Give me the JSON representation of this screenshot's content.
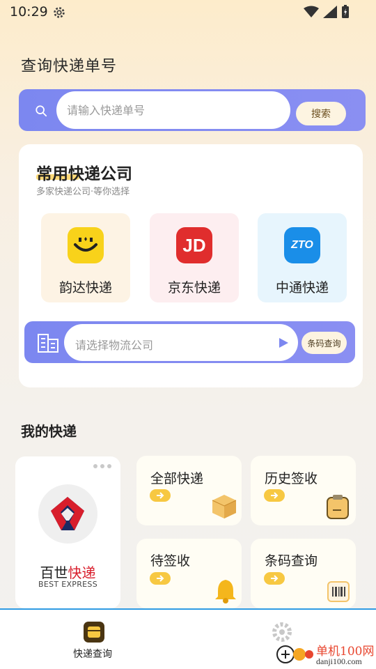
{
  "status_bar": {
    "time": "10:29"
  },
  "page_title": "查询快递单号",
  "search": {
    "placeholder": "请输入快递单号",
    "button_label": "搜索"
  },
  "common_couriers": {
    "title": "常用快递公司",
    "subtitle": "多家快递公司·等你选择",
    "companies": [
      {
        "name": "韵达快递",
        "logo": "yunda-logo",
        "bg": "#fdf3e4",
        "logo_color": "#f8d21a"
      },
      {
        "name": "京东快递",
        "logo": "jd-logo",
        "logo_text": "JD",
        "bg": "#fdeef0",
        "logo_color": "#e02d2d"
      },
      {
        "name": "中通快递",
        "logo": "zto-logo",
        "logo_text": "ZTO",
        "bg": "#e7f5fd",
        "logo_color": "#1a8ee8"
      }
    ],
    "picker": {
      "placeholder": "请选择物流公司",
      "barcode_button": "条码查询"
    }
  },
  "my_express": {
    "title": "我的快递",
    "featured": {
      "name_black": "百世",
      "name_red": "快递",
      "name_en": "BEST EXPRESS"
    },
    "cards": [
      {
        "label": "全部快递",
        "icon": "package-icon"
      },
      {
        "label": "历史签收",
        "icon": "clipboard-icon"
      },
      {
        "label": "待签收",
        "icon": "bell-icon"
      },
      {
        "label": "条码查询",
        "icon": "barcode-icon"
      }
    ]
  },
  "bottom_nav": {
    "home_label": "快递查询"
  },
  "watermark": {
    "cn": "单机100网",
    "url": "danji100.com"
  },
  "colors": {
    "accent": "#7c87f0",
    "yellow": "#f7c842"
  }
}
